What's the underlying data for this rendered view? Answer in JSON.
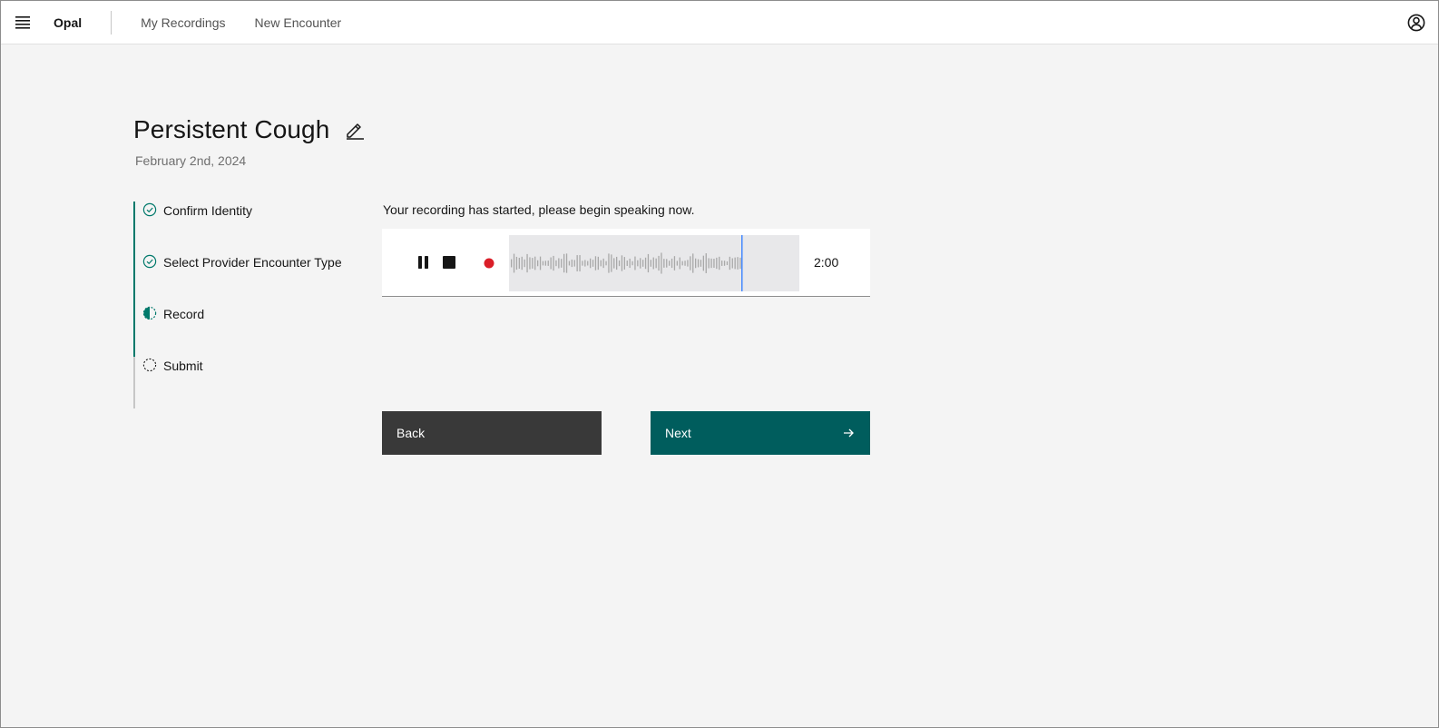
{
  "header": {
    "brand": "Opal",
    "nav": [
      {
        "label": "My Recordings"
      },
      {
        "label": "New Encounter"
      }
    ],
    "icons": {
      "menu": "hamburger-icon",
      "user": "user-avatar-icon"
    }
  },
  "page": {
    "title": "Persistent Cough",
    "date": "February 2nd, 2024"
  },
  "steps": [
    {
      "label": "Confirm Identity",
      "status": "complete"
    },
    {
      "label": "Select Provider Encounter Type",
      "status": "complete"
    },
    {
      "label": "Record",
      "status": "current"
    },
    {
      "label": "Submit",
      "status": "incomplete"
    }
  ],
  "recorder": {
    "instructions": "Your recording has started, please begin speaking now.",
    "timer": "2:00",
    "state": "recording",
    "colors": {
      "record_dot": "#da1e28",
      "playhead": "#4589ff",
      "wave": "#a8a8a8"
    }
  },
  "actions": {
    "back_label": "Back",
    "next_label": "Next"
  },
  "colors": {
    "accent": "#005d5d",
    "step_accent": "#00796b",
    "secondary_button": "#393939",
    "background": "#f4f4f4"
  }
}
